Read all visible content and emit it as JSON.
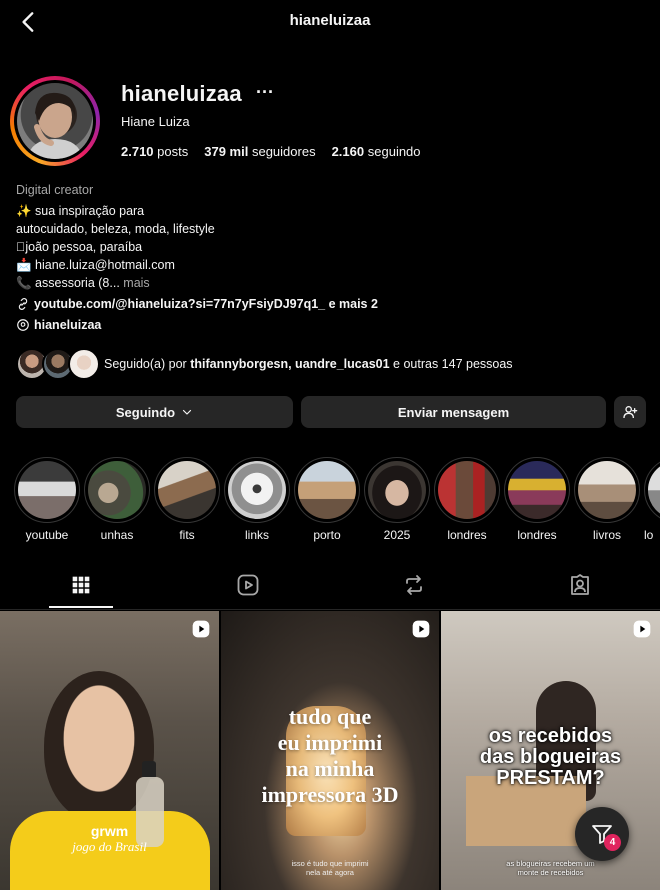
{
  "header": {
    "title": "hianeluizaa"
  },
  "profile": {
    "username": "hianeluizaa",
    "full_name": "Hiane Luiza",
    "stats": {
      "posts_value": "2.710",
      "posts_label": "posts",
      "followers_value": "379 mil",
      "followers_label": "seguidores",
      "following_value": "2.160",
      "following_label": "seguindo"
    },
    "category": "Digital creator",
    "bio": {
      "line1": "✨ sua inspiração para",
      "line2": "autocuidado, beleza, moda, lifestyle",
      "line3": "joão pessoa, paraíba",
      "line4": "📩 hiane.luiza@hotmail.com",
      "line5": "📞 assessoria (8...",
      "more": "mais"
    },
    "link_text": "youtube.com/@hianeluiza?si=77n7yFsiyDJ97q1_ e mais 2",
    "threads_handle": "hianeluizaa",
    "followed_by_prefix": "Seguido(a) por",
    "followed_by_names": "thifannyborgesn, uandre_lucas01",
    "followed_by_suffix": "e outras 147 pessoas"
  },
  "actions": {
    "following_label": "Seguindo",
    "message_label": "Enviar mensagem"
  },
  "highlights": [
    {
      "label": "youtube"
    },
    {
      "label": "unhas"
    },
    {
      "label": "fits"
    },
    {
      "label": "links"
    },
    {
      "label": "porto"
    },
    {
      "label": "2025"
    },
    {
      "label": "londres"
    },
    {
      "label": "londres"
    },
    {
      "label": "livros"
    },
    {
      "label": "lo"
    }
  ],
  "posts": [
    {
      "line1": "grwm",
      "line2": "jogo do Brasil"
    },
    {
      "title": "tudo que\neu imprimi\nna minha\nimpressora 3D",
      "caption": "isso é tudo que imprimi\nnela até agora"
    },
    {
      "title": "os recebidos\ndas blogueiras\nPRESTAM?",
      "caption": "as blogueiras recebem um\nmonte de recebidos"
    }
  ],
  "filter_badge": "4",
  "colors": {
    "background": "#000000",
    "button": "#262626",
    "badge": "#e0245e",
    "text": "#f5f5f5",
    "muted": "#a8a8a8"
  }
}
